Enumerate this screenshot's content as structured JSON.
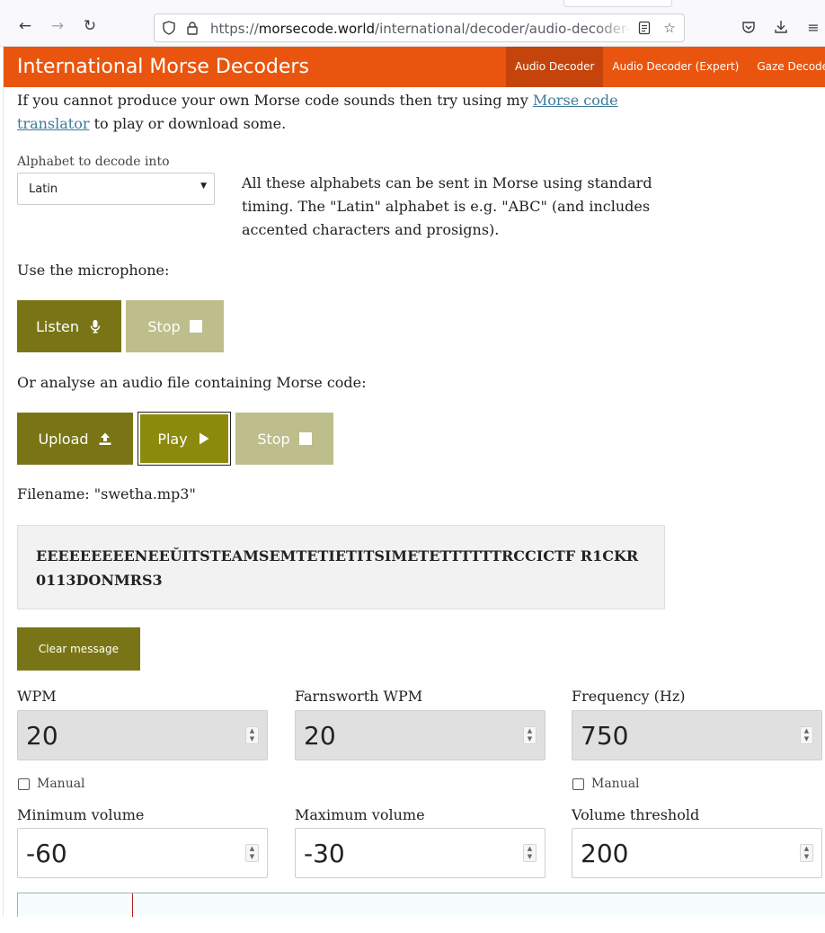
{
  "browser": {
    "url_prefix": "https://",
    "url_host": "morsecode.world",
    "url_path": "/international/decoder/audio-decoder-ada"
  },
  "site": {
    "title": "International Morse Decoders",
    "nav": [
      {
        "label": "Audio Decoder",
        "active": true
      },
      {
        "label": "Audio Decoder (Expert)",
        "active": false
      },
      {
        "label": "Gaze Decoder",
        "active": false
      }
    ]
  },
  "intro": {
    "text_before": "If you cannot produce your own Morse code sounds then try using my ",
    "link_text_1": "Morse code",
    "link_text_2": "translator",
    "text_after": " to play or download some."
  },
  "alphabet": {
    "label": "Alphabet to decode into",
    "selected": "Latin",
    "description": "All these alphabets can be sent in Morse using standard timing. The \"Latin\" alphabet is e.g. \"ABC\" (and includes accented characters and prosigns)."
  },
  "microphone": {
    "heading": "Use the microphone:",
    "listen_label": "Listen",
    "stop_label": "Stop"
  },
  "audio_file": {
    "heading": "Or analyse an audio file containing Morse code:",
    "upload_label": "Upload",
    "play_label": "Play",
    "stop_label": "Stop",
    "filename": "Filename: \"swetha.mp3\""
  },
  "decoded_message": "EEEEEEEEENEEŬITSTEAMSEMTETIETITSIMETETTTTTTRCCICTF R1CKR0113DONMRS3",
  "clear_label": "Clear message",
  "settings": {
    "wpm": {
      "label": "WPM",
      "value": "20"
    },
    "farnsworth": {
      "label": "Farnsworth WPM",
      "value": "20"
    },
    "frequency": {
      "label": "Frequency (Hz)",
      "value": "750"
    },
    "manual_label": "Manual",
    "min_volume": {
      "label": "Minimum volume",
      "value": "-60"
    },
    "max_volume": {
      "label": "Maximum volume",
      "value": "-30"
    },
    "threshold": {
      "label": "Volume threshold",
      "value": "200"
    }
  },
  "colors": {
    "header": "#e9550f",
    "button_dark": "#797516",
    "button_light": "#bdbe8b",
    "link": "#3c7b9b"
  }
}
